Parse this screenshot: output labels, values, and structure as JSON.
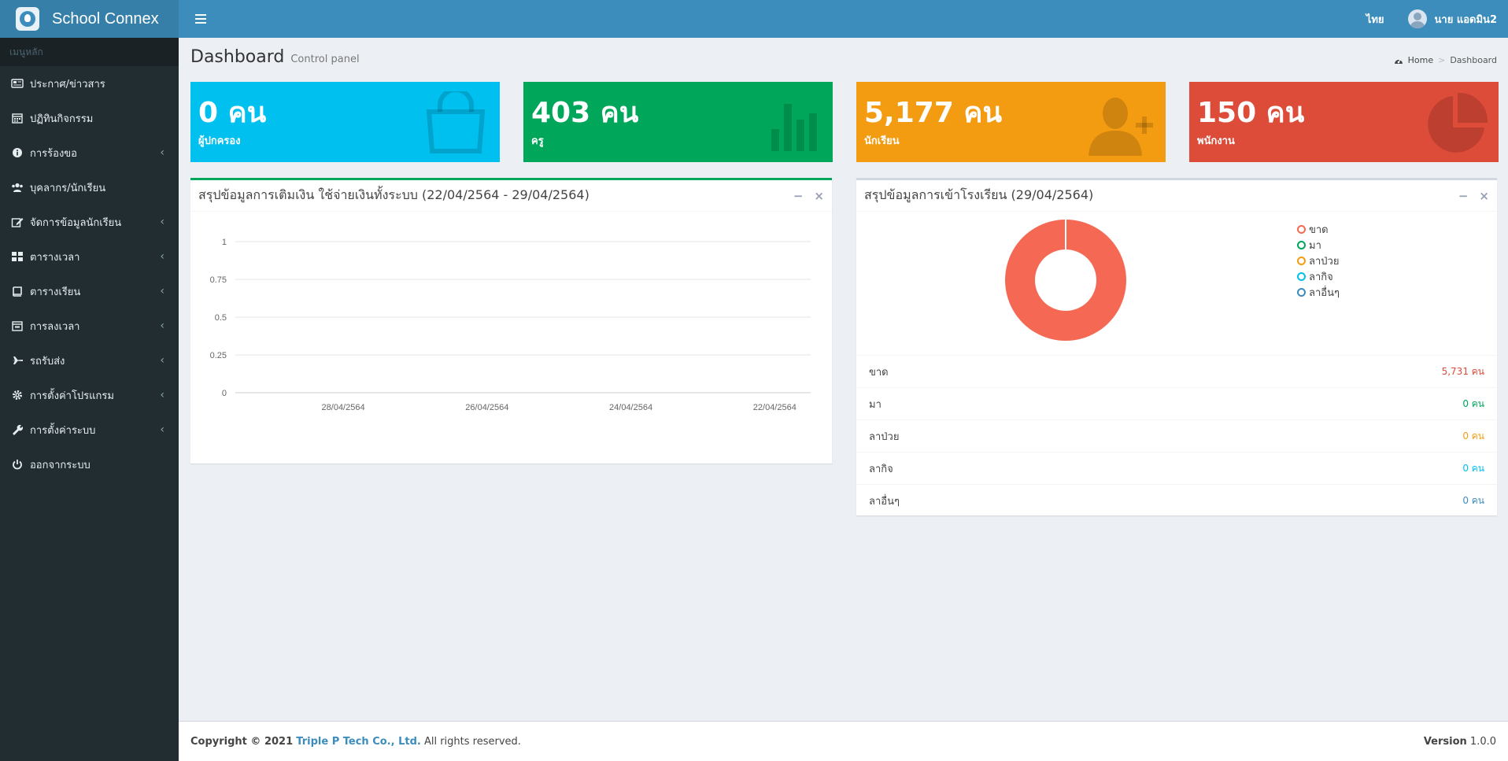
{
  "app": {
    "title": "School Connex"
  },
  "navbar": {
    "language": "ไทย",
    "user_name": "นาย แอดมิน2"
  },
  "sidebar": {
    "header": "เมนูหลัก",
    "items": [
      {
        "label": "ประกาศ/ข่าวสาร",
        "icon": "newspaper-icon",
        "has_submenu": false
      },
      {
        "label": "ปฏิทินกิจกรรม",
        "icon": "calendar-icon",
        "has_submenu": false
      },
      {
        "label": "การร้องขอ",
        "icon": "info-icon",
        "has_submenu": true
      },
      {
        "label": "บุคลากร/นักเรียน",
        "icon": "users-icon",
        "has_submenu": false
      },
      {
        "label": "จัดการข้อมูลนักเรียน",
        "icon": "edit-icon",
        "has_submenu": true
      },
      {
        "label": "ตารางเวลา",
        "icon": "grid-icon",
        "has_submenu": true
      },
      {
        "label": "ตารางเรียน",
        "icon": "book-icon",
        "has_submenu": true
      },
      {
        "label": "การลงเวลา",
        "icon": "calendar-check-icon",
        "has_submenu": true
      },
      {
        "label": "รถรับส่ง",
        "icon": "plane-icon",
        "has_submenu": true
      },
      {
        "label": "การตั้งค่าโปรแกรม",
        "icon": "gear-icon",
        "has_submenu": true
      },
      {
        "label": "การตั้งค่าระบบ",
        "icon": "wrench-icon",
        "has_submenu": true
      },
      {
        "label": "ออกจากระบบ",
        "icon": "power-icon",
        "has_submenu": false
      }
    ]
  },
  "content_header": {
    "title": "Dashboard",
    "subtitle": "Control panel"
  },
  "breadcrumb": {
    "home": "Home",
    "current": "Dashboard"
  },
  "stat_boxes": [
    {
      "value": "0 คน",
      "label": "ผู้ปกครอง",
      "color": "#00c0ef",
      "icon": "shopping-bag-icon"
    },
    {
      "value": "403 คน",
      "label": "ครู",
      "color": "#00a65a",
      "icon": "bar-chart-icon"
    },
    {
      "value": "5,177 คน",
      "label": "นักเรียน",
      "color": "#f39c12",
      "icon": "user-plus-icon"
    },
    {
      "value": "150 คน",
      "label": "พนักงาน",
      "color": "#dd4b39",
      "icon": "pie-chart-icon"
    }
  ],
  "topup_panel": {
    "title": "สรุปข้อมูลการเติมเงิน ใช้จ่ายเงินทั้งระบบ (22/04/2564 - 29/04/2564)"
  },
  "attendance_panel": {
    "title": "สรุปข้อมูลการเข้าโรงเรียน (29/04/2564)",
    "rows": [
      {
        "name": "ขาด",
        "value": "5,731 คน",
        "color": "#dd4b39"
      },
      {
        "name": "มา",
        "value": "0 คน",
        "color": "#00a65a"
      },
      {
        "name": "ลาป่วย",
        "value": "0 คน",
        "color": "#f39c12"
      },
      {
        "name": "ลากิจ",
        "value": "0 คน",
        "color": "#00c0ef"
      },
      {
        "name": "ลาอื่นๆ",
        "value": "0 คน",
        "color": "#3c8dbc"
      }
    ]
  },
  "chart_data": [
    {
      "type": "line",
      "x": [
        "28/04/2564",
        "26/04/2564",
        "24/04/2564",
        "22/04/2564"
      ],
      "series": [],
      "ylim": [
        0,
        1
      ],
      "yticks": [
        "1",
        "0.75",
        "0.5",
        "0.25",
        "0"
      ],
      "grid": true
    },
    {
      "type": "pie",
      "donut": true,
      "labels": [
        "ขาด",
        "มา",
        "ลาป่วย",
        "ลากิจ",
        "ลาอื่นๆ"
      ],
      "values": [
        5731,
        0,
        0,
        0,
        0
      ],
      "colors": [
        "#f56954",
        "#00a65a",
        "#f39c12",
        "#00c0ef",
        "#3c8dbc"
      ],
      "legend": "right"
    }
  ],
  "footer": {
    "copyright": "Copyright © 2021",
    "company": "Triple P Tech Co., Ltd.",
    "rights": "All rights reserved.",
    "version_label": "Version",
    "version": "1.0.0"
  }
}
